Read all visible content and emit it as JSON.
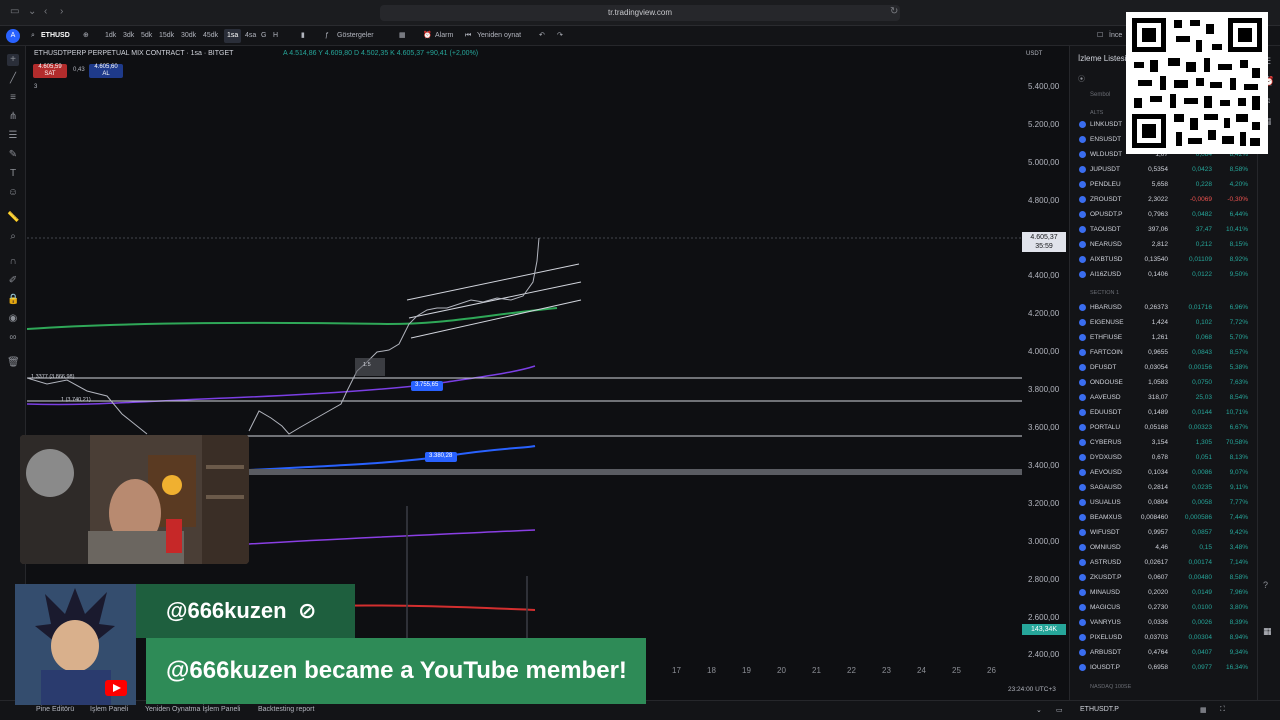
{
  "browser": {
    "url": "tr.tradingview.com"
  },
  "toolbar": {
    "symbol": "ETHUSD",
    "timeframes": [
      "1dk",
      "3dk",
      "5dk",
      "15dk",
      "30dk",
      "45dk",
      "1sa",
      "4sa",
      "G",
      "H"
    ],
    "active_timeframe": "1sa",
    "indicators_label": "Göstergeler",
    "alarm_label": "Alarm",
    "replay_label": "Yeniden oynat",
    "inspect_label": "İnce"
  },
  "chart": {
    "title": "ETHUSDTPERP PERPETUAL MIX CONTRACT · 1sa · BITGET",
    "ohlc": "A 4.514,86  Y 4.609,80  D 4.502,35  K 4.605,37  +90,41 (+2,00%)",
    "sell_price": "4.605,59",
    "sell_label": "SAT",
    "spread": "0,43",
    "buy_price": "4.605,60",
    "buy_label": "AL",
    "layers": "3",
    "currency": "USDT",
    "price_tag": "4.605,37",
    "countdown": "35:59",
    "volume_tag": "143,34K",
    "label_a": "3.755,65",
    "label_b": "3.380,28",
    "fib_text_1": "1.3377 (3.866,98)",
    "fib_text_2": "1 (3.740,21)",
    "box_text": "1.5",
    "y_ticks": [
      "5.400,00",
      "5.200,00",
      "5.000,00",
      "4.800,00",
      "4.400,00",
      "4.200,00",
      "4.000,00",
      "3.800,00",
      "3.600,00",
      "3.400,00",
      "3.200,00",
      "3.000,00",
      "2.800,00",
      "2.600,00",
      "2.400,00"
    ],
    "x_ticks": [
      "17",
      "18",
      "19",
      "20",
      "21",
      "22",
      "23",
      "24",
      "25",
      "26"
    ],
    "time_label": "23:24:00 UTC+3"
  },
  "watchlist": {
    "title": "İzleme Listesi",
    "column_symbol": "Sembol",
    "section_alts": "ALTS",
    "section_1": "SECTION 1",
    "section_nasdaq": "NASDAQ 100SE",
    "current_symbol": "ETHUSDT.P",
    "rows_top": [
      {
        "sym": "LINKUSDT",
        "last": "",
        "chg": "",
        "pct": "",
        "dir": "pos"
      },
      {
        "sym": "ENSUSDT",
        "last": "",
        "chg": "",
        "pct": "",
        "dir": "pos"
      },
      {
        "sym": "WLDUSDT",
        "last": "1,07",
        "chg": "0,084",
        "pct": "8,42%",
        "dir": "pos"
      },
      {
        "sym": "JUPUSDT",
        "last": "0,5354",
        "chg": "0,0423",
        "pct": "8,58%",
        "dir": "pos"
      },
      {
        "sym": "PENDLEU",
        "last": "5,658",
        "chg": "0,228",
        "pct": "4,20%",
        "dir": "pos"
      },
      {
        "sym": "ZROUSDT",
        "last": "2,3022",
        "chg": "-0,0069",
        "pct": "-0,30%",
        "dir": "neg"
      },
      {
        "sym": "OPUSDT.P",
        "last": "0,7963",
        "chg": "0,0482",
        "pct": "6,44%",
        "dir": "pos"
      },
      {
        "sym": "TAOUSDT",
        "last": "397,06",
        "chg": "37,47",
        "pct": "10,41%",
        "dir": "pos"
      },
      {
        "sym": "NEARUSD",
        "last": "2,812",
        "chg": "0,212",
        "pct": "8,15%",
        "dir": "pos"
      },
      {
        "sym": "AIXBTUSD",
        "last": "0,13540",
        "chg": "0,01109",
        "pct": "8,92%",
        "dir": "pos"
      },
      {
        "sym": "AI16ZUSD",
        "last": "0,1406",
        "chg": "0,0122",
        "pct": "9,50%",
        "dir": "pos"
      }
    ],
    "rows_section": [
      {
        "sym": "HBARUSD",
        "last": "0,26373",
        "chg": "0,01716",
        "pct": "6,96%",
        "dir": "pos"
      },
      {
        "sym": "EIGENUSE",
        "last": "1,424",
        "chg": "0,102",
        "pct": "7,72%",
        "dir": "pos"
      },
      {
        "sym": "ETHFIUSE",
        "last": "1,261",
        "chg": "0,068",
        "pct": "5,70%",
        "dir": "pos"
      },
      {
        "sym": "FARTCOIN",
        "last": "0,9655",
        "chg": "0,0843",
        "pct": "8,57%",
        "dir": "pos"
      },
      {
        "sym": "DFUSDT",
        "last": "0,03054",
        "chg": "0,00156",
        "pct": "5,38%",
        "dir": "pos"
      },
      {
        "sym": "ONDOUSE",
        "last": "1,0583",
        "chg": "0,0750",
        "pct": "7,63%",
        "dir": "pos"
      },
      {
        "sym": "AAVEUSD",
        "last": "318,07",
        "chg": "25,03",
        "pct": "8,54%",
        "dir": "pos"
      },
      {
        "sym": "EDUUSDT",
        "last": "0,1489",
        "chg": "0,0144",
        "pct": "10,71%",
        "dir": "pos"
      },
      {
        "sym": "PORTALU",
        "last": "0,05168",
        "chg": "0,00323",
        "pct": "6,67%",
        "dir": "pos"
      },
      {
        "sym": "CYBERUS",
        "last": "3,154",
        "chg": "1,305",
        "pct": "70,58%",
        "dir": "pos"
      },
      {
        "sym": "DYDXUSD",
        "last": "0,678",
        "chg": "0,051",
        "pct": "8,13%",
        "dir": "pos"
      },
      {
        "sym": "AEVOUSD",
        "last": "0,1034",
        "chg": "0,0086",
        "pct": "9,07%",
        "dir": "pos"
      },
      {
        "sym": "SAGAUSD",
        "last": "0,2814",
        "chg": "0,0235",
        "pct": "9,11%",
        "dir": "pos"
      },
      {
        "sym": "USUALUS",
        "last": "0,0804",
        "chg": "0,0058",
        "pct": "7,77%",
        "dir": "pos"
      },
      {
        "sym": "BEAMXUS",
        "last": "0,008460",
        "chg": "0,000586",
        "pct": "7,44%",
        "dir": "pos"
      },
      {
        "sym": "WIFUSDT",
        "last": "0,9957",
        "chg": "0,0857",
        "pct": "9,42%",
        "dir": "pos"
      },
      {
        "sym": "OMNIUSD",
        "last": "4,46",
        "chg": "0,15",
        "pct": "3,48%",
        "dir": "pos"
      },
      {
        "sym": "ASTRUSD",
        "last": "0,02617",
        "chg": "0,00174",
        "pct": "7,14%",
        "dir": "pos"
      },
      {
        "sym": "ZKUSDT.P",
        "last": "0,0607",
        "chg": "0,00480",
        "pct": "8,58%",
        "dir": "pos"
      },
      {
        "sym": "MINAUSD",
        "last": "0,2020",
        "chg": "0,0149",
        "pct": "7,96%",
        "dir": "pos"
      },
      {
        "sym": "MAGICUS",
        "last": "0,2730",
        "chg": "0,0100",
        "pct": "3,80%",
        "dir": "pos"
      },
      {
        "sym": "VANRYUS",
        "last": "0,0336",
        "chg": "0,0026",
        "pct": "8,39%",
        "dir": "pos"
      },
      {
        "sym": "PIXELUSD",
        "last": "0,03703",
        "chg": "0,00304",
        "pct": "8,94%",
        "dir": "pos"
      },
      {
        "sym": "ARBUSDT",
        "last": "0,4764",
        "chg": "0,0407",
        "pct": "9,34%",
        "dir": "pos"
      },
      {
        "sym": "IOUSDT.P",
        "last": "0,6958",
        "chg": "0,0977",
        "pct": "16,34%",
        "dir": "pos"
      }
    ]
  },
  "bottom": {
    "tabs": [
      "Pine Editörü",
      "İşlem Paneli",
      "Yeniden Oynatma İşlem Paneli",
      "Backtesting report"
    ]
  },
  "overlay": {
    "member_name": "@666kuzen",
    "member_message": "@666kuzen became a YouTube member!"
  },
  "colors": {
    "accent": "#2962ff",
    "up": "#26a69a",
    "down": "#ef5350",
    "member_dark": "#1e5f3e",
    "member_light": "#2e8b57"
  }
}
